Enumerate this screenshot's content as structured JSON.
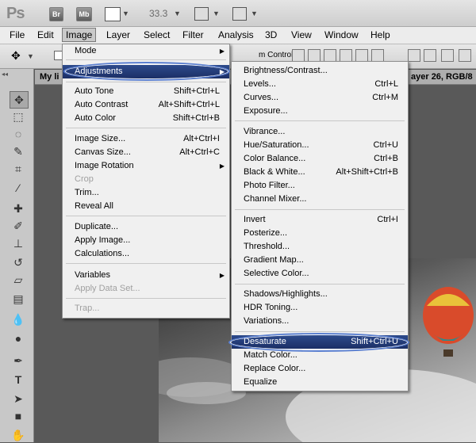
{
  "appbar": {
    "logo": "Ps",
    "bridge_label": "Br",
    "minibridge_label": "Mb",
    "zoom": "33.3"
  },
  "menubar": [
    "File",
    "Edit",
    "Image",
    "Layer",
    "Select",
    "Filter",
    "Analysis",
    "3D",
    "View",
    "Window",
    "Help"
  ],
  "options_bar": {
    "auto_controls": "m Controls"
  },
  "document": {
    "tab_name": "My li",
    "tab_info": "ayer 26, RGB/8"
  },
  "image_menu": {
    "items": [
      {
        "label": "Mode",
        "shortcut": "",
        "submenu": true
      },
      {
        "label": "Adjustments",
        "shortcut": "",
        "submenu": true,
        "highlighted": true
      },
      {
        "label": "Auto Tone",
        "shortcut": "Shift+Ctrl+L"
      },
      {
        "label": "Auto Contrast",
        "shortcut": "Alt+Shift+Ctrl+L"
      },
      {
        "label": "Auto Color",
        "shortcut": "Shift+Ctrl+B"
      },
      {
        "label": "Image Size...",
        "shortcut": "Alt+Ctrl+I"
      },
      {
        "label": "Canvas Size...",
        "shortcut": "Alt+Ctrl+C"
      },
      {
        "label": "Image Rotation",
        "shortcut": "",
        "submenu": true
      },
      {
        "label": "Crop",
        "shortcut": "",
        "disabled": true
      },
      {
        "label": "Trim...",
        "shortcut": ""
      },
      {
        "label": "Reveal All",
        "shortcut": ""
      },
      {
        "label": "Duplicate...",
        "shortcut": ""
      },
      {
        "label": "Apply Image...",
        "shortcut": ""
      },
      {
        "label": "Calculations...",
        "shortcut": ""
      },
      {
        "label": "Variables",
        "shortcut": "",
        "submenu": true
      },
      {
        "label": "Apply Data Set...",
        "shortcut": "",
        "disabled": true
      },
      {
        "label": "Trap...",
        "shortcut": "",
        "disabled": true
      }
    ]
  },
  "adjustments_menu": {
    "items": [
      {
        "label": "Brightness/Contrast...",
        "shortcut": ""
      },
      {
        "label": "Levels...",
        "shortcut": "Ctrl+L"
      },
      {
        "label": "Curves...",
        "shortcut": "Ctrl+M"
      },
      {
        "label": "Exposure...",
        "shortcut": ""
      },
      {
        "label": "Vibrance...",
        "shortcut": ""
      },
      {
        "label": "Hue/Saturation...",
        "shortcut": "Ctrl+U"
      },
      {
        "label": "Color Balance...",
        "shortcut": "Ctrl+B"
      },
      {
        "label": "Black & White...",
        "shortcut": "Alt+Shift+Ctrl+B"
      },
      {
        "label": "Photo Filter...",
        "shortcut": ""
      },
      {
        "label": "Channel Mixer...",
        "shortcut": ""
      },
      {
        "label": "Invert",
        "shortcut": "Ctrl+I"
      },
      {
        "label": "Posterize...",
        "shortcut": ""
      },
      {
        "label": "Threshold...",
        "shortcut": ""
      },
      {
        "label": "Gradient Map...",
        "shortcut": ""
      },
      {
        "label": "Selective Color...",
        "shortcut": ""
      },
      {
        "label": "Shadows/Highlights...",
        "shortcut": ""
      },
      {
        "label": "HDR Toning...",
        "shortcut": ""
      },
      {
        "label": "Variations...",
        "shortcut": ""
      },
      {
        "label": "Desaturate",
        "shortcut": "Shift+Ctrl+U",
        "highlighted": true
      },
      {
        "label": "Match Color...",
        "shortcut": ""
      },
      {
        "label": "Replace Color...",
        "shortcut": ""
      },
      {
        "label": "Equalize",
        "shortcut": ""
      }
    ]
  },
  "colors": {
    "highlight": "#1f3570",
    "ring": "#5a7fd0"
  }
}
